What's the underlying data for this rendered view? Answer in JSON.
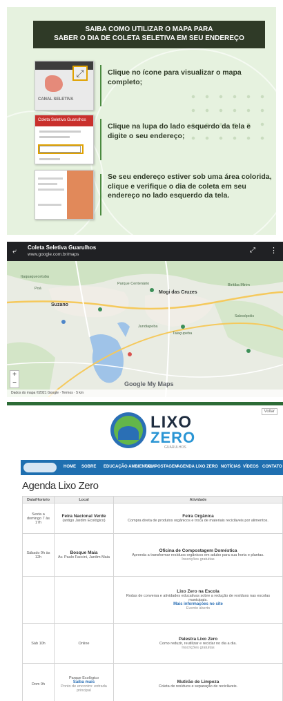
{
  "info": {
    "banner_line1": "SAIBA COMO UTILIZAR O MAPA PARA",
    "banner_line2": "SABER O DIA DE COLETA SELETIVA EM SEU ENDEREÇO",
    "steps": [
      {
        "text": "Clique no ícone para visualizar o mapa completo;"
      },
      {
        "text": "Clique na lupa do lado esquerdo da tela e digite o seu endereço;"
      },
      {
        "text": "Se seu endereço estiver sob uma área colorida, clique e verifique o dia de coleta em seu endereço no lado esquerdo da tela."
      }
    ],
    "thumb1_label": "CANAL SELETIVA",
    "thumb2_header": "Coleta Seletiva Guarulhos"
  },
  "map": {
    "title": "Coleta Seletiva Guarulhos",
    "subtitle": "www.google.com.br/maps",
    "places": {
      "suzano": "Suzano",
      "mogi": "Mogi das Cruzes",
      "itaquaquecetuba": "Itaquaquecetuba",
      "poa": "Poá",
      "parque": "Parque Centenário",
      "biritiba": "Biritiba Mirim",
      "salesopolis": "Salesópolis",
      "jundiapeba": "Jundiapeba",
      "taiacupeba": "Taiaçupeba"
    },
    "google_logo": "Google My Maps",
    "zoom_in": "+",
    "zoom_out": "−",
    "footer": "Dados do mapa ©2021 Google · Termos · 5 km"
  },
  "web": {
    "corner_link": "Voltar",
    "logo": {
      "word1": "LIXO",
      "word2": "ZERO",
      "tagline": "GUARULHOS"
    },
    "nav": [
      "HOME",
      "SOBRE",
      "EDUCAÇÃO AMBIENTAL",
      "COMPOSTAGEM",
      "AGENDA LIXO ZERO",
      "NOTÍCIAS",
      "VÍDEOS",
      "CONTATO"
    ],
    "agenda_title": "Agenda Lixo Zero",
    "columns": [
      "Data/Horário",
      "Local",
      "Atividade"
    ],
    "rows": [
      {
        "date": "Sexta a domingo 7 às 17h",
        "local_title": "Feira Nacional Verde",
        "local_sub": "(antigo Jardim Ecológico)",
        "act_title": "Feira Orgânica",
        "act_text": "Compra direta de produtos orgânicos e troca de materiais recicláveis por alimentos.",
        "act_link": "",
        "act_extra": ""
      },
      {
        "date": "Sábado 9h às 12h",
        "local_title": "Bosque Maia",
        "local_sub": "Av. Paulo Faccini, Jardim Maia",
        "act_title": "Oficina de Compostagem Doméstica",
        "act_text": "Aprenda a transformar resíduos orgânicos em adubo para sua horta e plantas.",
        "act_link": "",
        "act_extra": "Inscrições gratuitas"
      },
      {
        "date": "",
        "local_title": "",
        "local_sub": "",
        "act_title": "Lixo Zero na Escola",
        "act_text": "Rodas de conversa e atividades educativas sobre a redução de resíduos nas escolas municipais.",
        "act_link": "Mais informações no site",
        "act_extra": "Evento aberto"
      },
      {
        "date": "Sáb 10h",
        "local_title": "Online",
        "local_sub": "",
        "act_title": "Palestra Lixo Zero",
        "act_text": "Como reduzir, reutilizar e reciclar no dia a dia.",
        "act_link": "",
        "act_extra": "Inscrições gratuitas"
      },
      {
        "date": "Dom 9h",
        "local_title": "Parque Ecológico",
        "local_sub": "Ponto de encontro: entrada principal",
        "act_title": "Mutirão de Limpeza",
        "act_text": "Coleta de resíduos e separação de recicláveis.",
        "act_link": "Saiba mais",
        "act_extra": ""
      }
    ]
  }
}
